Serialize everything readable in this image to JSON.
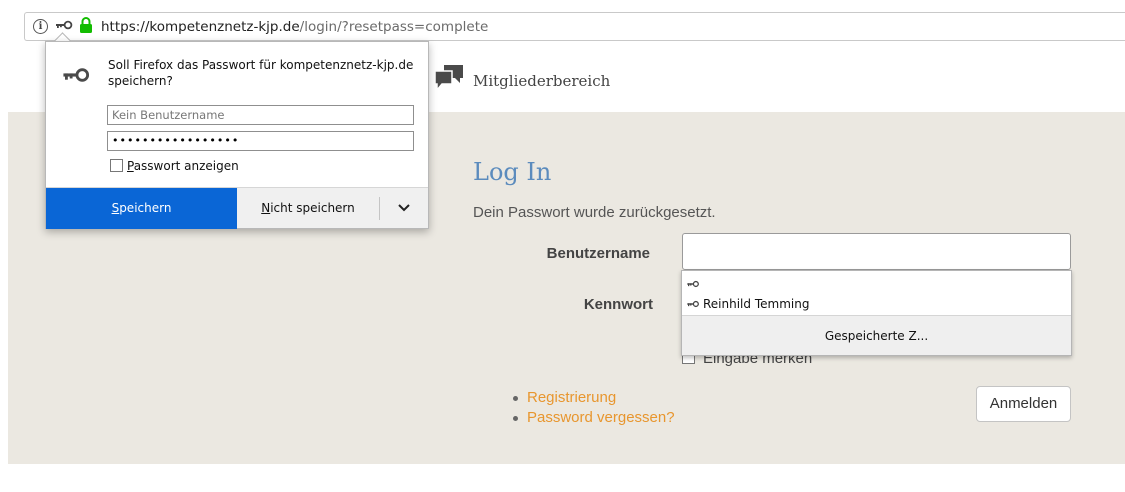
{
  "urlbar": {
    "url_host": "https://kompetenznetz-kjp.de",
    "url_path": "/login/?resetpass=complete",
    "info_icon": "i"
  },
  "site": {
    "members_label": "Mitgliederbereich"
  },
  "login": {
    "title": "Log In",
    "message": "Dein Passwort wurde zurückgesetzt.",
    "username_label": "Benutzername",
    "username_value": "",
    "password_label": "Kennwort",
    "remember_label": "Eingabe merken",
    "links": [
      "Registrierung",
      "Password vergessen?"
    ],
    "submit_label": "Anmelden"
  },
  "autocomplete": {
    "entry_empty": "",
    "entry_user": "Reinhild Temming",
    "footer": "Gespeicherte Z..."
  },
  "doorhanger": {
    "message": "Soll Firefox das Passwort für kompetenznetz-kjp.de speichern?",
    "username_placeholder": "Kein Benutzername",
    "password_dots": "•••••••••••••••••",
    "show_password_first": "P",
    "show_password_rest": "asswort anzeigen",
    "save_first": "S",
    "save_rest": "peichern",
    "nosave_first": "N",
    "nosave_rest": "icht speichern"
  },
  "colors": {
    "accent_blue": "#0a66d6",
    "title_blue": "#5b8bbd",
    "link_orange": "#e8962e",
    "content_bg": "#ebe8e1",
    "lock_green": "#12bc00"
  },
  "icons": [
    "info-icon",
    "key-icon",
    "lock-icon",
    "chat-bubbles-icon",
    "chevron-down-icon"
  ]
}
